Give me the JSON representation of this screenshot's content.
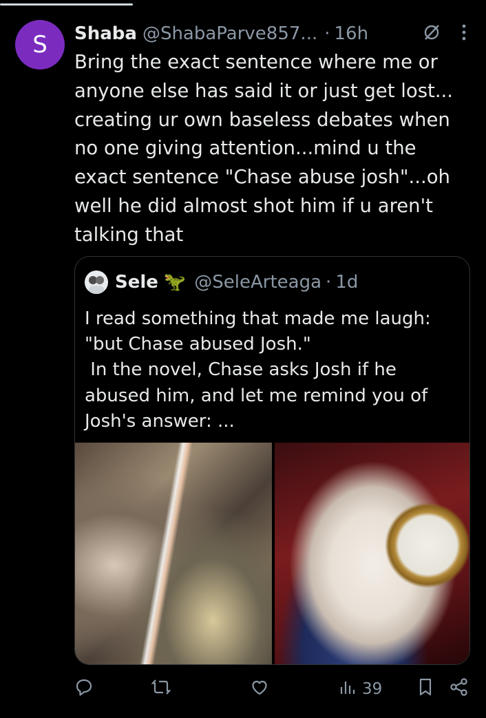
{
  "post": {
    "avatar_letter": "S",
    "author_name": "Shaba",
    "author_handle": "@ShabaParve857...",
    "separator": "·",
    "time": "16h",
    "text": "Bring the exact sentence where me or anyone else has said it or just get lost... creating ur own baseless debates when no one giving attention...mind u the exact sentence \"Chase abuse josh\"...oh well he did almost shot him if u aren't talking that"
  },
  "quoted_post": {
    "author_name": "Sele",
    "author_emoji": "🦖",
    "author_handle": "@SeleArteaga",
    "separator": "·",
    "time": "1d",
    "text_lines": [
      "I read something that made me laugh:",
      "\"but Chase abused Josh.\"",
      " In the novel, Chase asks Josh if he abused him, and let me remind you of Josh's answer: ..."
    ],
    "images": [
      "manhwa-action-scene",
      "white-rabbit-pocket-watch"
    ]
  },
  "actions": {
    "views_count": "39"
  },
  "icons": {
    "header": [
      "grok-icon",
      "more-icon"
    ],
    "action_bar": [
      "reply-icon",
      "repost-icon",
      "like-icon",
      "views-icon",
      "bookmark-icon",
      "share-icon"
    ]
  },
  "colors": {
    "background": "#000000",
    "text": "#e7e9ea",
    "secondary": "#8b98a5",
    "avatar": "#7b2cbf",
    "border": "#2f3336"
  }
}
